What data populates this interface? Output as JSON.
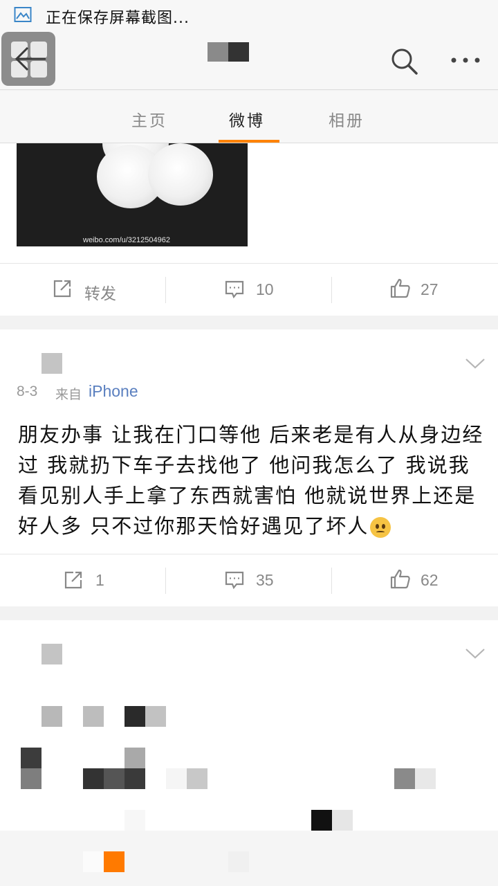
{
  "status_bar": {
    "text": "正在保存屏幕截图...",
    "icon": "image-icon"
  },
  "nav": {
    "back_icon": "back-arrow-icon",
    "search_icon": "search-icon",
    "more_icon": "more-dots-icon"
  },
  "tabs": [
    {
      "label": "主页",
      "active": false
    },
    {
      "label": "微博",
      "active": true
    },
    {
      "label": "相册",
      "active": false
    }
  ],
  "accent_color": "#ff8200",
  "post1": {
    "image_watermark": "weibo.com/u/3212504962",
    "actions": {
      "repost_label": "转发",
      "comments": "10",
      "likes": "27"
    }
  },
  "post2": {
    "time": "8-3",
    "from_label": "来自",
    "source": "iPhone",
    "text": "朋友办事 让我在门口等他 后来老是有人从身边经过 我就扔下车子去找他了 他问我怎么了 我说我看见别人手上拿了东西就害怕 他就说世界上还是好人多 只不过你那天恰好遇见了坏人",
    "emoji": "sad-face-emoji",
    "actions": {
      "reposts": "1",
      "comments": "35",
      "likes": "62"
    }
  }
}
